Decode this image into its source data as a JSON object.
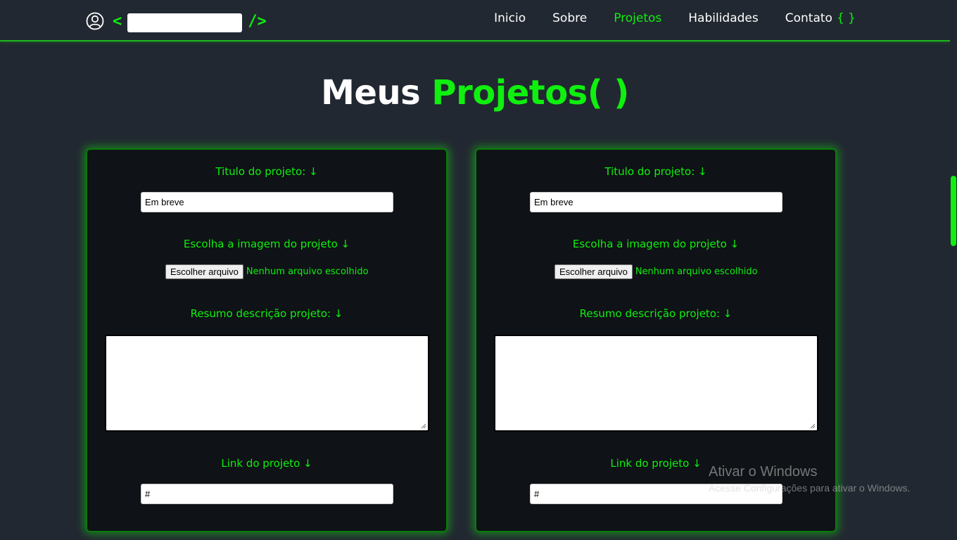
{
  "header": {
    "logo": {
      "left_bracket": "<",
      "right_bracket": "/>",
      "icon": "user-circle-icon"
    },
    "nav": [
      {
        "label": "Inicio",
        "active": false
      },
      {
        "label": "Sobre",
        "active": false
      },
      {
        "label": "Projetos",
        "active": true
      },
      {
        "label": "Habilidades",
        "active": false
      },
      {
        "label": "Contato",
        "active": false
      }
    ],
    "contact_braces": "{ }"
  },
  "page_title": {
    "white": "Meus",
    "accent": "Projetos( )"
  },
  "cards": [
    {
      "title_label": "Titulo do projeto: ↓",
      "title_value": "Em breve",
      "image_label": "Escolha a imagem do projeto ↓",
      "file_button": "Escolher arquivo",
      "file_status": "Nenhum arquivo escolhido",
      "summary_label": "Resumo descrição projeto: ↓",
      "summary_value": "",
      "link_label": "Link do projeto ↓",
      "link_value": "#"
    },
    {
      "title_label": "Titulo do projeto: ↓",
      "title_value": "Em breve",
      "image_label": "Escolha a imagem do projeto ↓",
      "file_button": "Escolher arquivo",
      "file_status": "Nenhum arquivo escolhido",
      "summary_label": "Resumo descrição projeto: ↓",
      "summary_value": "",
      "link_label": "Link do projeto ↓",
      "link_value": "#"
    }
  ],
  "watermark": {
    "line1": "Ativar o Windows",
    "line2": "Acesse Configurações para ativar o Windows."
  },
  "colors": {
    "background": "#222831",
    "accent": "#0ff00f",
    "card": "#0f1216"
  }
}
